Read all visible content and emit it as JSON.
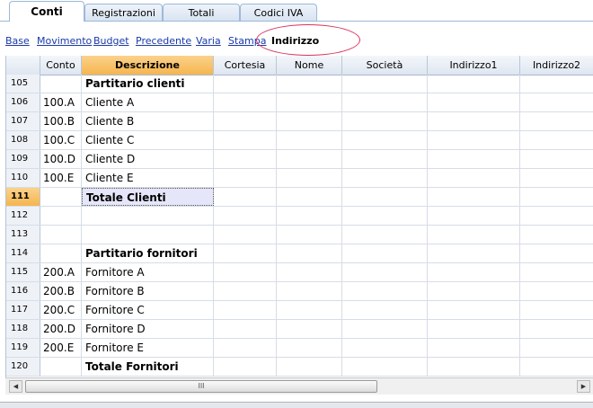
{
  "tabs": [
    {
      "label": "Conti",
      "active": true
    },
    {
      "label": "Registrazioni",
      "active": false
    },
    {
      "label": "Totali",
      "active": false
    },
    {
      "label": "Codici IVA",
      "active": false
    }
  ],
  "views": [
    "Base",
    "Movimento",
    "Budget",
    "Precedente",
    "Varia",
    "Stampa"
  ],
  "active_view": "Indirizzo",
  "columns": [
    "Conto",
    "Descrizione",
    "Cortesia",
    "Nome",
    "Società",
    "Indirizzo1",
    "Indirizzo2"
  ],
  "rows": [
    {
      "num": "105",
      "conto": "",
      "descrizione": "Partitario clienti",
      "bold": true
    },
    {
      "num": "106",
      "conto": "100.A",
      "descrizione": "Cliente A",
      "bold": false
    },
    {
      "num": "107",
      "conto": "100.B",
      "descrizione": "Cliente B",
      "bold": false
    },
    {
      "num": "108",
      "conto": "100.C",
      "descrizione": "Cliente C",
      "bold": false
    },
    {
      "num": "109",
      "conto": "100.D",
      "descrizione": "Cliente D",
      "bold": false
    },
    {
      "num": "110",
      "conto": "100.E",
      "descrizione": "Cliente E",
      "bold": false
    },
    {
      "num": "111",
      "conto": "",
      "descrizione": "Totale Clienti",
      "bold": true
    },
    {
      "num": "112",
      "conto": "",
      "descrizione": "",
      "bold": false
    },
    {
      "num": "113",
      "conto": "",
      "descrizione": "",
      "bold": false
    },
    {
      "num": "114",
      "conto": "",
      "descrizione": "Partitario fornitori",
      "bold": true
    },
    {
      "num": "115",
      "conto": "200.A",
      "descrizione": "Fornitore A",
      "bold": false
    },
    {
      "num": "116",
      "conto": "200.B",
      "descrizione": "Fornitore B",
      "bold": false
    },
    {
      "num": "117",
      "conto": "200.C",
      "descrizione": "Fornitore C",
      "bold": false
    },
    {
      "num": "118",
      "conto": "200.D",
      "descrizione": "Fornitore D",
      "bold": false
    },
    {
      "num": "119",
      "conto": "200.E",
      "descrizione": "Fornitore E",
      "bold": false
    },
    {
      "num": "120",
      "conto": "",
      "descrizione": "Totale Fornitori",
      "bold": true
    }
  ],
  "selected_row": "111",
  "selected_column": "Descrizione",
  "scrollbar": {
    "grip": "III"
  },
  "colors": {
    "accent_header": "#f5b54f",
    "link": "#1a3aa8",
    "highlight_oval": "#d9335e"
  }
}
